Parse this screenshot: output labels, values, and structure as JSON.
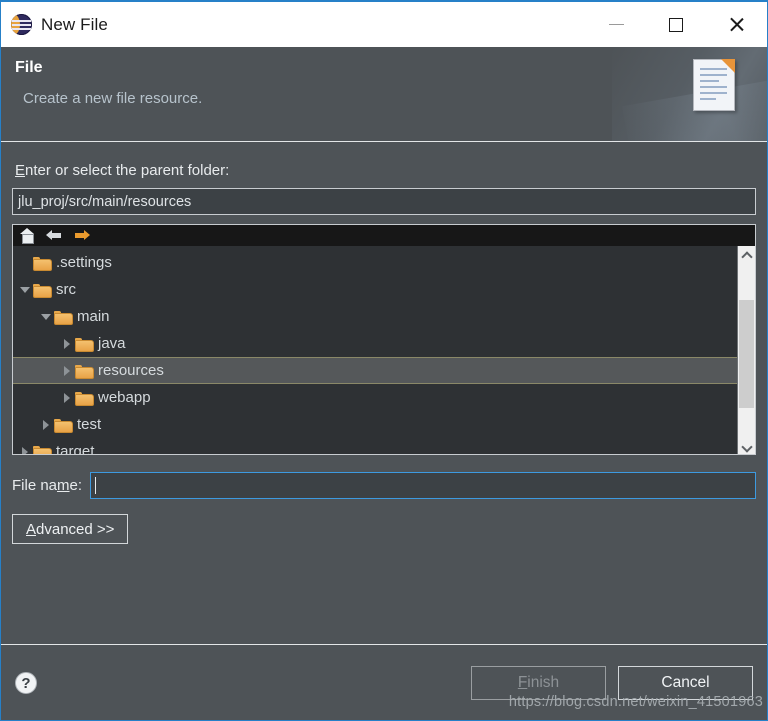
{
  "window": {
    "title": "New File",
    "logo_icon": "eclipse-logo",
    "controls": {
      "minimize": "minimize-icon",
      "maximize": "maximize-icon",
      "close": "close-icon"
    }
  },
  "header": {
    "title": "File",
    "subtitle": "Create a new file resource.",
    "banner_icon": "new-file-document-icon"
  },
  "parent_folder": {
    "label_mnemonic": "E",
    "label_rest": "nter or select the parent folder:",
    "value": "jlu_proj/src/main/resources"
  },
  "tree_toolbar": {
    "home": "home-icon",
    "back": "back-arrow-icon",
    "forward": "forward-arrow-icon"
  },
  "tree": {
    "items": [
      {
        "label": ".settings",
        "depth": 1,
        "state": "leaf",
        "selected": false
      },
      {
        "label": "src",
        "depth": 1,
        "state": "expanded",
        "selected": false
      },
      {
        "label": "main",
        "depth": 2,
        "state": "expanded",
        "selected": false
      },
      {
        "label": "java",
        "depth": 3,
        "state": "collapsed",
        "selected": false
      },
      {
        "label": "resources",
        "depth": 3,
        "state": "collapsed",
        "selected": true
      },
      {
        "label": "webapp",
        "depth": 3,
        "state": "collapsed",
        "selected": false
      },
      {
        "label": "test",
        "depth": 2,
        "state": "collapsed",
        "selected": false
      },
      {
        "label": "target",
        "depth": 1,
        "state": "collapsed",
        "selected": false
      }
    ],
    "scrollbar": {
      "up": "chevron-up-icon",
      "down": "chevron-down-icon"
    }
  },
  "file_name": {
    "label_pre": "File na",
    "label_mnemonic": "m",
    "label_post": "e:",
    "value": "",
    "placeholder": ""
  },
  "advanced": {
    "mnemonic": "A",
    "rest": "dvanced >>"
  },
  "footer": {
    "help": "?",
    "finish_mnemonic": "F",
    "finish_rest": "inish",
    "finish_enabled": false,
    "cancel_label": "Cancel"
  },
  "watermark": {
    "text": "https://blog.csdn.net/weixin_41501963"
  },
  "colors": {
    "dialog_bg": "#4e5357",
    "titlebar_bg": "#ffffff",
    "accent_border": "#2680c8",
    "tree_bg": "#2e3134",
    "selection_bg": "#55585a",
    "selection_border": "#8a8868",
    "folder_orange": "#e8a247",
    "focus_border": "#3d9ae0",
    "subtitle_text": "#b7c3cc"
  }
}
